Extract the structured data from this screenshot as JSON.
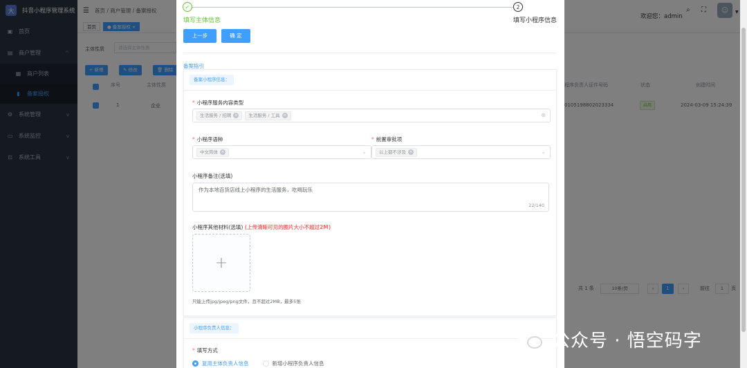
{
  "sidebar": {
    "title": "抖音小程序管理系统",
    "menu": [
      {
        "label": "首页",
        "icon": "dashboard-icon"
      },
      {
        "label": "商户管理",
        "icon": "shop-icon",
        "expanded": true
      },
      {
        "label": "商户列表",
        "icon": "list-icon",
        "sub": true
      },
      {
        "label": "备案授权",
        "icon": "file-icon",
        "sub": true,
        "active": true
      },
      {
        "label": "系统管理",
        "icon": "gear-icon"
      },
      {
        "label": "系统监控",
        "icon": "monitor-icon"
      },
      {
        "label": "系统工具",
        "icon": "tool-icon"
      }
    ]
  },
  "header": {
    "breadcrumb": "首页 / 商户管理 / 备案授权",
    "welcome": "欢迎您：admin"
  },
  "tags": {
    "home": "首页",
    "current": "● 备案授权 ×"
  },
  "background": {
    "filter_label": "主体性质",
    "filter_placeholder": "请选择主体性质",
    "btn_add": "+ 新增",
    "btn_edit": "✎ 修改",
    "btn_delete": "🗑 删除",
    "col_index": "序号",
    "col_nature": "主体性质",
    "col_id": "程序负责人证件号码",
    "col_status": "状态",
    "col_created": "创建时间",
    "row_index": "1",
    "row_nature": "企业",
    "row_id": "0105198802023334",
    "row_status": "启用",
    "row_created": "2024-03-09 15:24:39",
    "pager_total": "共 1 条",
    "pager_size": "10条/页",
    "pager_page": "1",
    "pager_goto": "前往",
    "pager_goto_val": "1",
    "pager_page_suffix": "页"
  },
  "dialog": {
    "step1": "填写主体信息",
    "step2": "填写小程序信息",
    "step2_num": "2",
    "btn_prev": "上一步",
    "btn_ok": "确 定",
    "guide": "备案指引",
    "card1_title": "备案小程序信息：",
    "service_label": "小程序服务内容类型",
    "service_chips": [
      "生活服务 / 招聘",
      "生活服务 / 工具"
    ],
    "lang_label": "小程序语种",
    "lang_chip": "中文简体",
    "preapprove_label": "前置审批项",
    "preapprove_chip": "以上都不涉及",
    "remark_label": "小程序备注(选填)",
    "remark_value": "作为本地百货店线上小程序的生活服务，吃喝玩乐",
    "remark_count": "22/140",
    "material_label": "小程序其他材料(选填)",
    "material_warn": "(上传清晰可见的图片大小不超过2M)",
    "upload_tip": "只能上传jpg/jpeg/png文件，且不超过2MB，最多5张",
    "card2_title": "小程序负责人信息：",
    "fill_label": "填写方式",
    "radio_1": "复用主体负责人信息",
    "radio_2": "新增小程序负责人信息"
  },
  "watermark": "公众号 · 悟空码字",
  "colors": {
    "primary": "#409eff",
    "success": "#67c23a",
    "danger": "#f56c6c",
    "sidebar": "#2b3543"
  }
}
